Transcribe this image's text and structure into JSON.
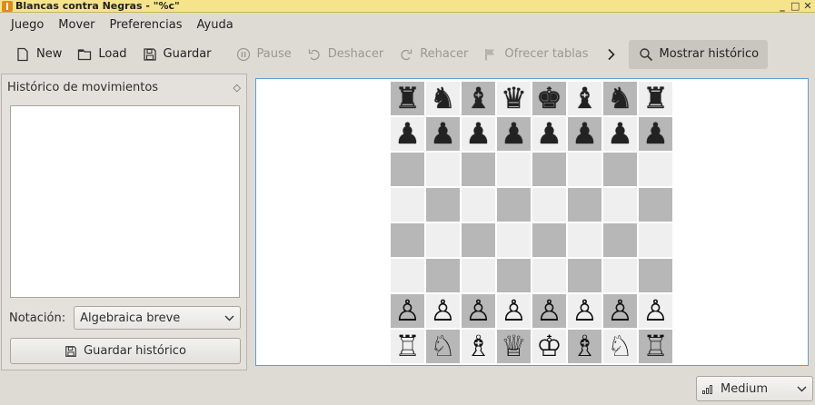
{
  "window": {
    "title": "Blancas contra Negras - \"%c\"",
    "controls": [
      "_",
      "□",
      "✕"
    ]
  },
  "menubar": {
    "items": [
      "Juego",
      "Mover",
      "Preferencias",
      "Ayuda"
    ]
  },
  "toolbar": {
    "new_label": "New",
    "load_label": "Load",
    "save_label": "Guardar",
    "pause_label": "Pause",
    "undo_label": "Deshacer",
    "redo_label": "Rehacer",
    "draw_label": "Ofrecer tablas",
    "history_label": "Mostrar histórico"
  },
  "sidepanel": {
    "title": "Histórico de movimientos",
    "notation_label": "Notación:",
    "notation_value": "Algebraica breve",
    "save_history_label": "Guardar histórico"
  },
  "board": {
    "rows": [
      [
        "♜",
        "♞",
        "♝",
        "♛",
        "♚",
        "♝",
        "♞",
        "♜"
      ],
      [
        "♟",
        "♟",
        "♟",
        "♟",
        "♟",
        "♟",
        "♟",
        "♟"
      ],
      [
        "",
        "",
        "",
        "",
        "",
        "",
        "",
        ""
      ],
      [
        "",
        "",
        "",
        "",
        "",
        "",
        "",
        ""
      ],
      [
        "",
        "",
        "",
        "",
        "",
        "",
        "",
        ""
      ],
      [
        "",
        "",
        "",
        "",
        "",
        "",
        "",
        ""
      ],
      [
        "♙",
        "♙",
        "♙",
        "♙",
        "♙",
        "♙",
        "♙",
        "♙"
      ],
      [
        "♖",
        "♘",
        "♗",
        "♕",
        "♔",
        "♗",
        "♘",
        "♖"
      ]
    ]
  },
  "difficulty": {
    "value": "Medium"
  }
}
